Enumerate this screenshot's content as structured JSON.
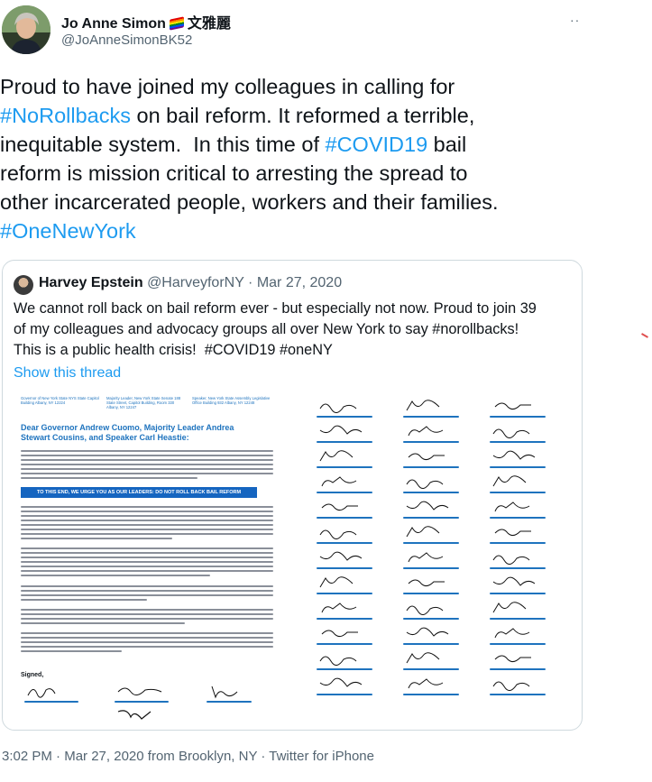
{
  "author": {
    "name": "Jo Anne Simon",
    "name_cjk": "文雅麗",
    "handle": "@JoAnneSimonBK52",
    "flag_icon": "rainbow-flag-icon"
  },
  "tweet": {
    "text_parts": [
      {
        "text": "Proud to have joined my colleagues in calling for\n",
        "tag": false
      },
      {
        "text": "#NoRollbacks",
        "tag": true
      },
      {
        "text": " on bail reform. It reformed a terrible,\ninequitable system.  In this time of ",
        "tag": false
      },
      {
        "text": "#COVID19",
        "tag": true
      },
      {
        "text": " bail\nreform is mission critical to arresting the spread to\nother incarcerated people, workers and their families.\n",
        "tag": false
      },
      {
        "text": "#OneNewYork",
        "tag": true
      }
    ]
  },
  "quoted": {
    "name": "Harvey Epstein",
    "handle": "@HarveyforNY",
    "date": "· Mar 27, 2020",
    "text": "We cannot roll back on bail reform ever - but especially not now. Proud to join 39\nof my colleagues and advocacy groups all over New York to say #norollbacks!\nThis is a public health crisis!  #COVID19 #oneNY",
    "show_thread": "Show this thread",
    "letter": {
      "addresses": [
        "Governor of New York State\nNYS State Capitol Building\nAlbany, NY 12224",
        "Majority Leader, New York State Senate\n188 State Street, Capitol Building, Room 330\nAlbany, NY 12247",
        "Speaker, New York State Assembly\nLegislative Office Building 932\nAlbany, NY 12248"
      ],
      "title": "Dear Governor Andrew Cuomo, Majority Leader Andrea Stewart Cousins, and Speaker Carl Heastie:",
      "banner": "TO THIS END, WE URGE YOU AS OUR LEADERS: DO NOT ROLL BACK BAIL REFORM",
      "signed": "Signed,"
    }
  },
  "footer": {
    "time": "3:02 PM",
    "date": "Mar 27, 2020 from Brooklyn, NY",
    "source": "Twitter for iPhone"
  },
  "colors": {
    "link": "#1d9bf0",
    "secondary_text": "#536471",
    "border": "#cfd9de",
    "letter_blue": "#1e73be"
  }
}
